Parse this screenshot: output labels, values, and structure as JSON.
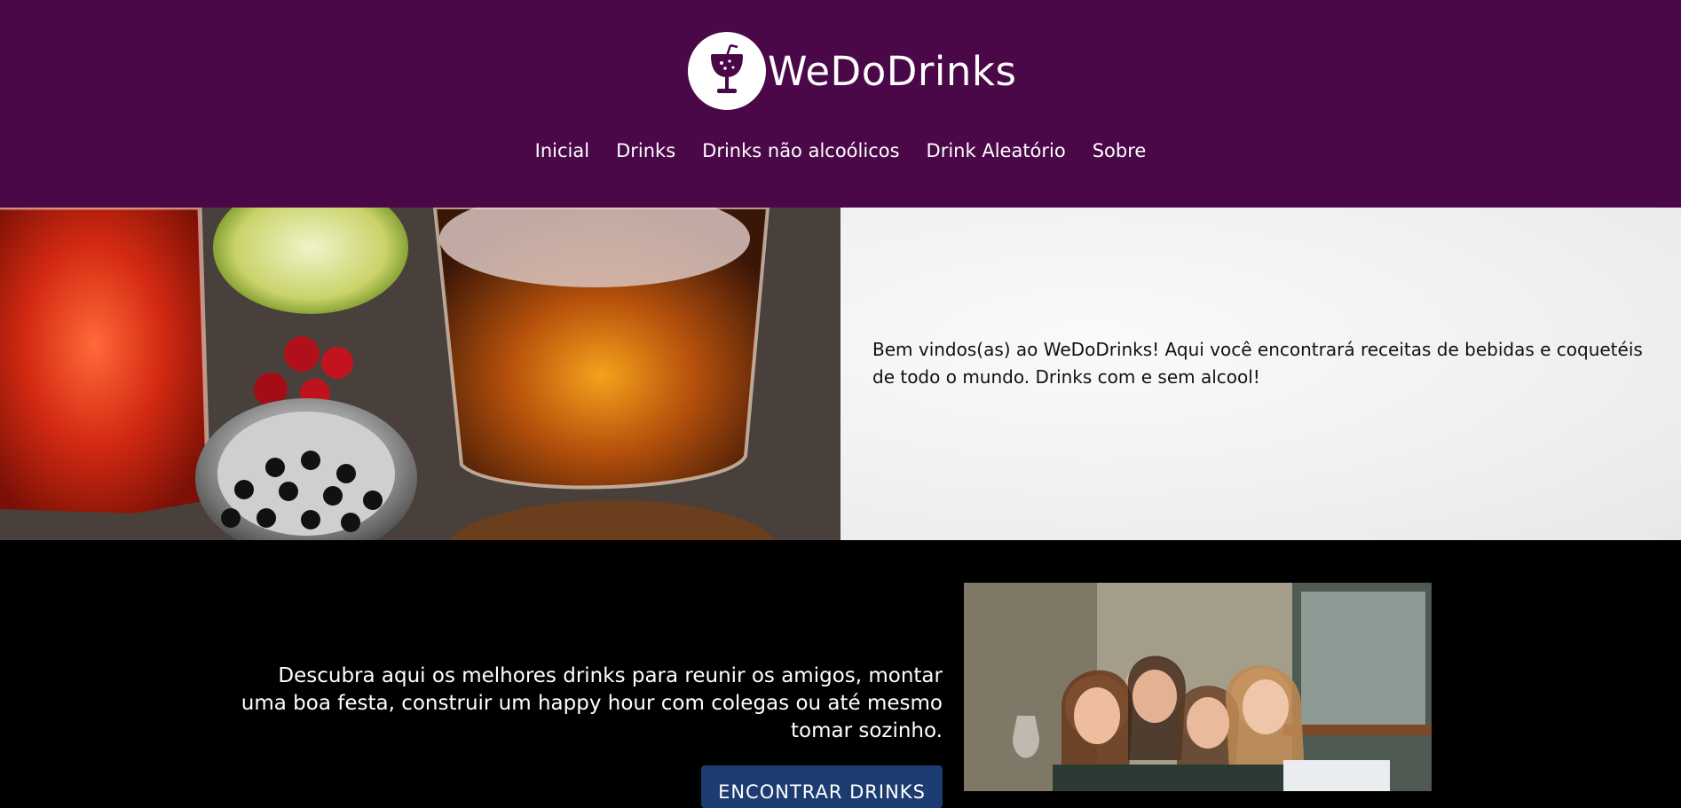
{
  "site": {
    "name": "WeDoDrinks",
    "logo_icon": "cocktail-glass-icon",
    "brand_color": "#4a0848"
  },
  "nav": {
    "items": [
      {
        "label": "Inicial"
      },
      {
        "label": "Drinks"
      },
      {
        "label": "Drinks não alcoólicos"
      },
      {
        "label": "Drink Aleatório"
      },
      {
        "label": "Sobre"
      }
    ]
  },
  "hero": {
    "image": "cocktails-photo",
    "text": "Bem vindos(as) ao WeDoDrinks! Aqui você encontrará receitas de bebidas e coquetéis de todo o mundo. Drinks com e sem alcool!"
  },
  "promo": {
    "text": "Descubra aqui os melhores drinks para reunir os amigos, montar uma boa festa, construir um happy hour com colegas ou até mesmo tomar sozinho.",
    "button_label": "ENCONTRAR DRINKS",
    "button_color": "#1d3d72",
    "image": "friends-party-photo"
  }
}
